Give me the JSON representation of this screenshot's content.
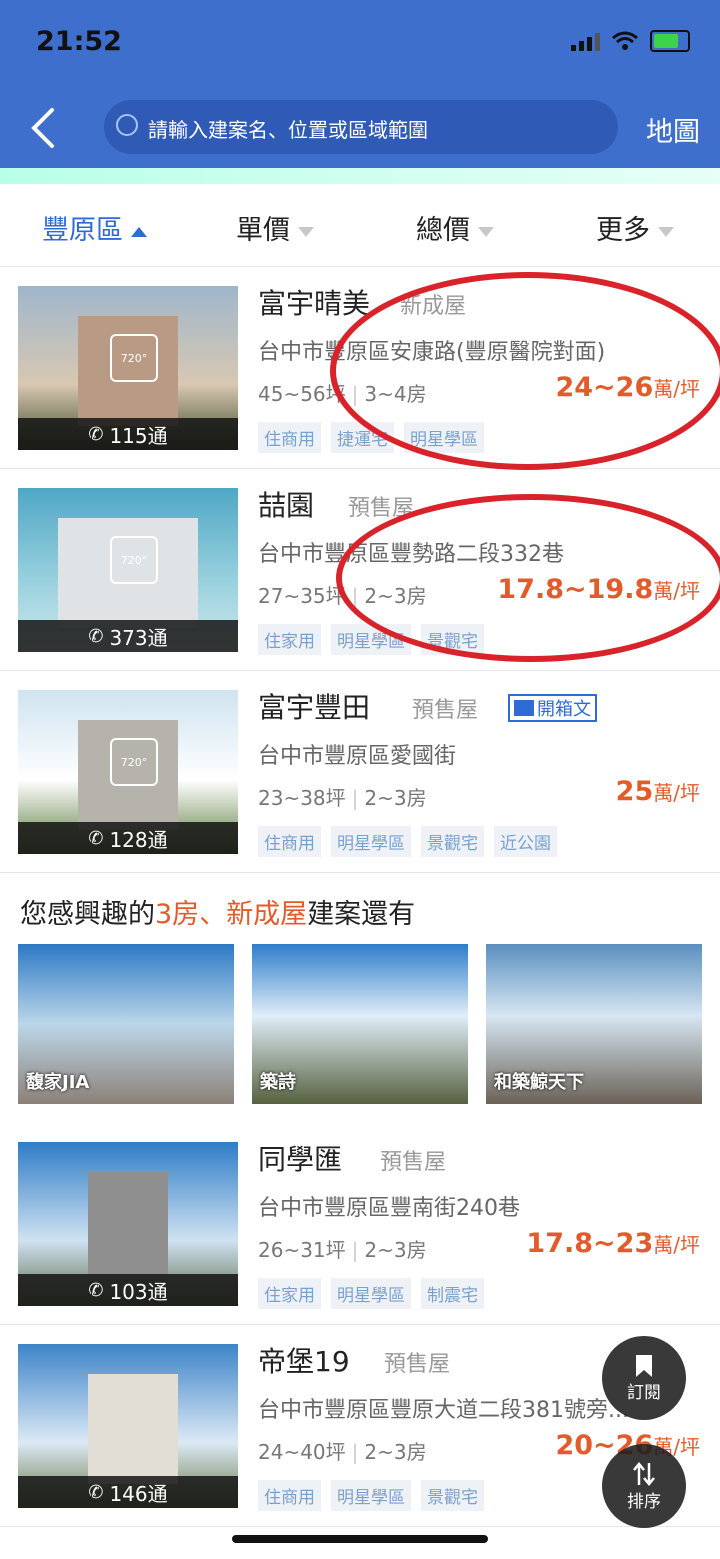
{
  "status": {
    "time": "21:52"
  },
  "header": {
    "search_placeholder": "請輸入建案名、位置或區域範圍",
    "map_label": "地圖"
  },
  "filters": [
    {
      "label": "豐原區",
      "active": true
    },
    {
      "label": "單價",
      "active": false
    },
    {
      "label": "總價",
      "active": false
    },
    {
      "label": "更多",
      "active": false
    }
  ],
  "listings": [
    {
      "title": "富宇晴美",
      "kind": "新成屋",
      "address": "台中市豐原區安康路(豐原醫院對面)",
      "size": "45~56坪",
      "rooms": "3~4房",
      "price": "24~26",
      "unit": "萬/坪",
      "calls": "115通",
      "tags": [
        "住商用",
        "捷運宅",
        "明星學區"
      ]
    },
    {
      "title": "喆園",
      "kind": "預售屋",
      "address": "台中市豐原區豐勢路二段332巷",
      "size": "27~35坪",
      "rooms": "2~3房",
      "price": "17.8~19.8",
      "unit": "萬/坪",
      "calls": "373通",
      "tags": [
        "住家用",
        "明星學區",
        "景觀宅"
      ]
    },
    {
      "title": "富宇豐田",
      "kind": "預售屋",
      "address": "台中市豐原區愛國街",
      "size": "23~38坪",
      "rooms": "2~3房",
      "price": "25",
      "unit": "萬/坪",
      "calls": "128通",
      "tags": [
        "住商用",
        "明星學區",
        "景觀宅",
        "近公園"
      ],
      "badge": "開箱文"
    },
    {
      "title": "同學匯",
      "kind": "預售屋",
      "address": "台中市豐原區豐南街240巷",
      "size": "26~31坪",
      "rooms": "2~3房",
      "price": "17.8~23",
      "unit": "萬/坪",
      "calls": "103通",
      "tags": [
        "住家用",
        "明星學區",
        "制震宅"
      ]
    },
    {
      "title": "帝堡19",
      "kind": "預售屋",
      "address": "台中市豐原區豐原大道二段381號旁...",
      "size": "24~40坪",
      "rooms": "2~3房",
      "price": "20~26",
      "unit": "萬/坪",
      "calls": "146通",
      "tags": [
        "住商用",
        "明星學區",
        "景觀宅"
      ]
    }
  ],
  "interest": {
    "prefix": "您感興趣的",
    "rooms": "3房",
    "sep": "、",
    "type": "新成屋",
    "suffix": "建案還有",
    "items": [
      "馥家JIA",
      "築詩",
      "和築鯨天下"
    ]
  },
  "fab": {
    "subscribe": "訂閱",
    "sort": "排序"
  },
  "panorama_label": "720°"
}
